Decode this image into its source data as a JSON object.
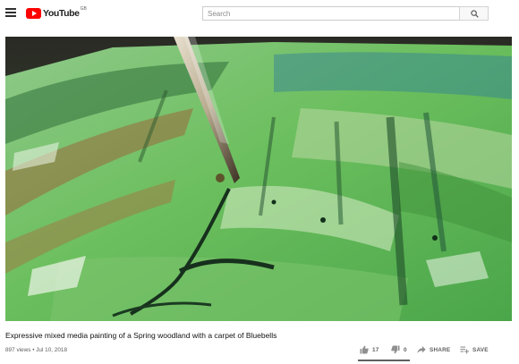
{
  "header": {
    "logo_text": "YouTube",
    "logo_country": "GB",
    "search_placeholder": "Search"
  },
  "video": {
    "title": "Expressive mixed media painting of a Spring woodland with a carpet of Bluebells",
    "meta": "897 views • Jul 10, 2018",
    "likes": "17",
    "dislikes": "0",
    "share_label": "SHARE",
    "save_label": "SAVE",
    "like_ratio": 1.0
  },
  "icons": {
    "menu": "hamburger-menu-icon",
    "search": "magnifier-icon",
    "like": "thumbs-up-icon",
    "dislike": "thumbs-down-icon",
    "share": "share-arrow-icon",
    "save": "playlist-add-icon"
  },
  "colors": {
    "brand_red": "#ff0000",
    "painting_green": "#5db85a"
  }
}
